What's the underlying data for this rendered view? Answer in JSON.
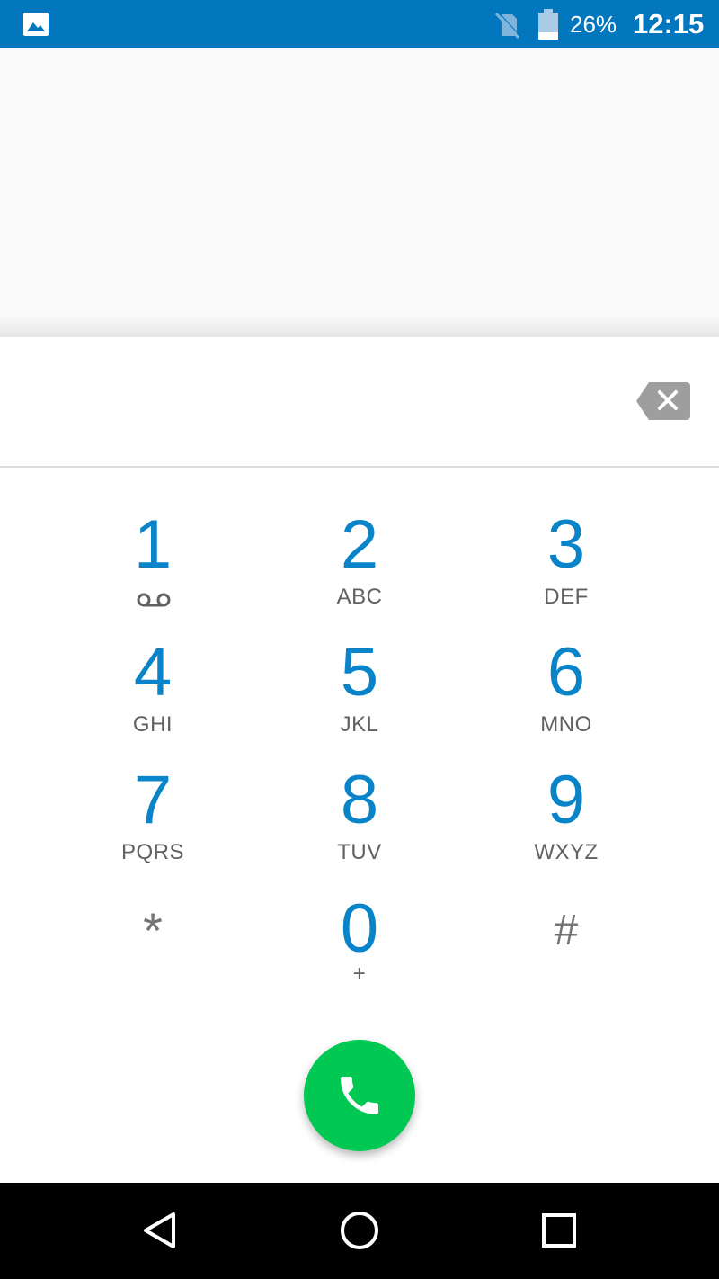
{
  "status_bar": {
    "battery_percent": "26%",
    "clock": "12:15",
    "icons": [
      "image-notification-icon",
      "no-sim-icon",
      "battery-icon"
    ]
  },
  "dialer": {
    "digits_value": "",
    "keys": [
      {
        "digit": "1",
        "letters": "",
        "icon": "voicemail-icon"
      },
      {
        "digit": "2",
        "letters": "ABC"
      },
      {
        "digit": "3",
        "letters": "DEF"
      },
      {
        "digit": "4",
        "letters": "GHI"
      },
      {
        "digit": "5",
        "letters": "JKL"
      },
      {
        "digit": "6",
        "letters": "MNO"
      },
      {
        "digit": "7",
        "letters": "PQRS"
      },
      {
        "digit": "8",
        "letters": "TUV"
      },
      {
        "digit": "9",
        "letters": "WXYZ"
      },
      {
        "digit": "*",
        "letters": ""
      },
      {
        "digit": "0",
        "letters": "+"
      },
      {
        "digit": "#",
        "letters": ""
      }
    ]
  },
  "colors": {
    "status_bar": "#0277bd",
    "digit": "#0a84c8",
    "call_button": "#00c853",
    "nav_bar": "#000000"
  }
}
